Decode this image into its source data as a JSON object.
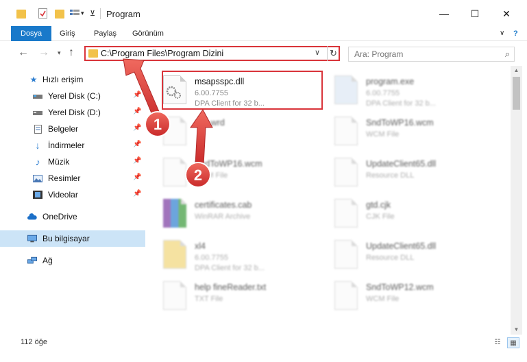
{
  "window": {
    "title": "Program",
    "minimize": "—",
    "maximize": "☐",
    "close": "✕",
    "help": "?",
    "expand": "∨"
  },
  "ribbon": {
    "tabs": [
      {
        "label": "Dosya"
      },
      {
        "label": "Giriş"
      },
      {
        "label": "Paylaş"
      },
      {
        "label": "Görünüm"
      }
    ]
  },
  "address": {
    "path": "C:\\Program Files\\Program Dizini",
    "search_placeholder": "Ara: Program"
  },
  "sidebar": {
    "items": [
      {
        "label": "Hızlı erişim",
        "icon": "star-icon"
      },
      {
        "label": "Yerel Disk (C:)",
        "icon": "drive-icon"
      },
      {
        "label": "Yerel Disk (D:)",
        "icon": "drive-icon"
      },
      {
        "label": "Belgeler",
        "icon": "documents-icon"
      },
      {
        "label": "İndirmeler",
        "icon": "download-icon"
      },
      {
        "label": "Müzik",
        "icon": "music-icon"
      },
      {
        "label": "Resimler",
        "icon": "pictures-icon"
      },
      {
        "label": "Videolar",
        "icon": "videos-icon"
      },
      {
        "label": "OneDrive",
        "icon": "cloud-icon"
      },
      {
        "label": "Bu bilgisayar",
        "icon": "computer-icon"
      },
      {
        "label": "Ağ",
        "icon": "network-icon"
      }
    ]
  },
  "files": [
    {
      "name": "msapsspc.dll",
      "line1": "6.00.7755",
      "line2": "DPA Client for 32 b..."
    },
    {
      "name": "program.exe",
      "line1": "6.00.7755",
      "line2": "DPA Client for 32 b..."
    },
    {
      "name": "abc.wrd",
      "line1": "",
      "line2": ""
    },
    {
      "name": "SndToWP16.wcm",
      "line1": "WCM File",
      "line2": ""
    },
    {
      "name": "SndToWP16.wcm",
      "line1": "WCM File",
      "line2": ""
    },
    {
      "name": "UpdateClient65.dll",
      "line1": "Resource DLL",
      "line2": ""
    },
    {
      "name": "certificates.cab",
      "line1": "WinRAR Archive",
      "line2": ""
    },
    {
      "name": "gtd.cjk",
      "line1": "CJK File",
      "line2": ""
    },
    {
      "name": "xl4",
      "line1": "6.00.7755",
      "line2": "DPA Client for 32 b..."
    },
    {
      "name": "UpdateClient65.dll",
      "line1": "Resource DLL",
      "line2": ""
    },
    {
      "name": "help fineReader.txt",
      "line1": "TXT File",
      "line2": ""
    },
    {
      "name": "SndToWP12.wcm",
      "line1": "WCM File",
      "line2": ""
    }
  ],
  "status": {
    "count": "112 öğe"
  },
  "annotations": {
    "badge1": "1",
    "badge2": "2"
  },
  "colors": {
    "accent": "#1979ca",
    "highlight": "#d9343a",
    "selected": "#cce4f7"
  }
}
